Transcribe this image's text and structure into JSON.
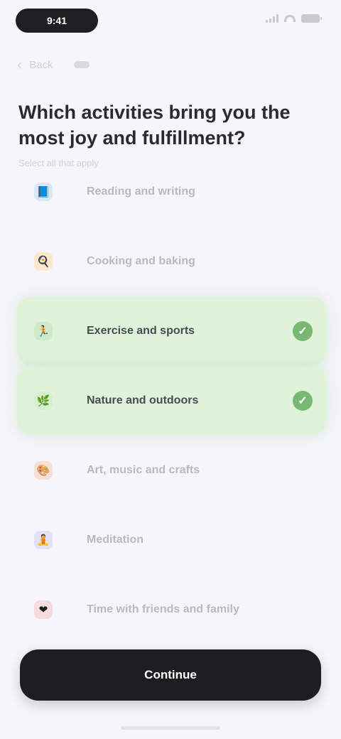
{
  "status_bar": {
    "time": "9:41"
  },
  "nav": {
    "back_label": "Back"
  },
  "heading": "Which activities bring you the most joy and fulfillment?",
  "subheading": "Select all that apply",
  "options": [
    {
      "label": "Reading and writing",
      "icon": "book-icon",
      "glyph": "📘",
      "icon_bg": "#d8e8fb",
      "selected": false
    },
    {
      "label": "Cooking and baking",
      "icon": "chef-icon",
      "glyph": "🍳",
      "icon_bg": "#fbe8cf",
      "selected": false
    },
    {
      "label": "Exercise and sports",
      "icon": "sport-icon",
      "glyph": "🏃",
      "icon_bg": "#cfeac8",
      "selected": true
    },
    {
      "label": "Nature and outdoors",
      "icon": "leaf-icon",
      "glyph": "🌿",
      "icon_bg": "#d7efd0",
      "selected": true
    },
    {
      "label": "Art, music and crafts",
      "icon": "palette-icon",
      "glyph": "🎨",
      "icon_bg": "#f6e0d6",
      "selected": false
    },
    {
      "label": "Meditation",
      "icon": "meditation-icon",
      "glyph": "🧘",
      "icon_bg": "#e2e2f6",
      "selected": false
    },
    {
      "label": "Time with friends and family",
      "icon": "heart-icon",
      "glyph": "❤",
      "icon_bg": "#f8d9dc",
      "selected": false
    }
  ],
  "check_glyph": "✓",
  "continue_label": "Continue",
  "colors": {
    "selected_bg": "#dff3db",
    "check": "#79b871",
    "button": "#1e1e21"
  }
}
